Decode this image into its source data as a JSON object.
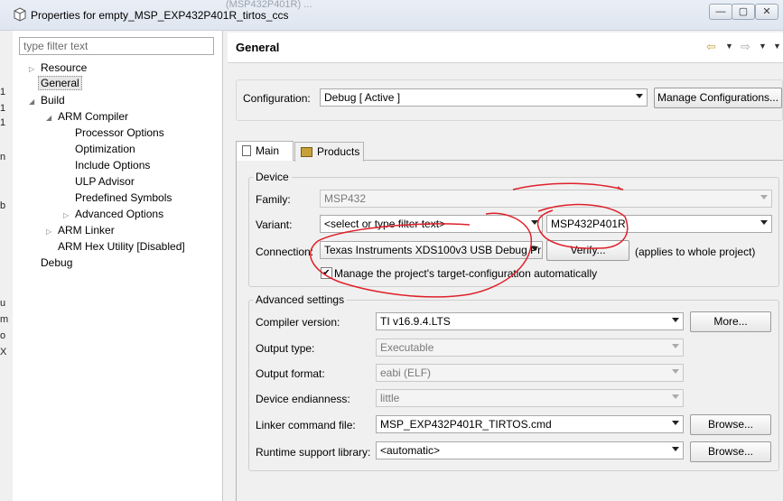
{
  "window": {
    "title": "Properties for empty_MSP_EXP432P401R_tirtos_ccs",
    "background_text": "(MSP432P401R) ...",
    "minimize": "—",
    "maximize": "▢",
    "close": "✕"
  },
  "gutter": [
    "1",
    "1",
    "1",
    "n",
    "b",
    "u",
    "m",
    "o",
    "X"
  ],
  "sidebar": {
    "filter_placeholder": "type filter text",
    "items": [
      {
        "label": "Resource",
        "expandable": true
      },
      {
        "label": "General",
        "selected": true
      },
      {
        "label": "Build",
        "expandable": true,
        "expanded": true
      },
      {
        "label": "ARM Compiler",
        "expandable": true,
        "expanded": true
      },
      {
        "label": "Processor Options"
      },
      {
        "label": "Optimization"
      },
      {
        "label": "Include Options"
      },
      {
        "label": "ULP Advisor"
      },
      {
        "label": "Predefined Symbols"
      },
      {
        "label": "Advanced Options",
        "expandable": true
      },
      {
        "label": "ARM Linker",
        "expandable": true
      },
      {
        "label": "ARM Hex Utility  [Disabled]"
      },
      {
        "label": "Debug"
      }
    ]
  },
  "header": {
    "title": "General"
  },
  "configuration": {
    "label": "Configuration:",
    "value": "Debug  [ Active ]",
    "manage_button": "Manage Configurations..."
  },
  "tabs": [
    {
      "label": "Main",
      "active": true,
      "icon": "main-page-icon"
    },
    {
      "label": "Products",
      "active": false,
      "icon": "products-icon"
    }
  ],
  "device": {
    "group_title": "Device",
    "family_label": "Family:",
    "family_value": "MSP432",
    "variant_label": "Variant:",
    "variant_filter": "<select or type filter text>",
    "variant_value": "MSP432P401R",
    "connection_label": "Connection:",
    "connection_value": "Texas Instruments XDS100v3 USB Debug Pr",
    "verify_button": "Verify...",
    "connection_note": "(applies to whole project)",
    "manage_checkbox_label": "Manage the project's target-configuration automatically",
    "manage_checked": true
  },
  "advanced": {
    "group_title": "Advanced settings",
    "compiler_label": "Compiler version:",
    "compiler_value": "TI v16.9.4.LTS",
    "more_button": "More...",
    "output_type_label": "Output type:",
    "output_type_value": "Executable",
    "output_format_label": "Output format:",
    "output_format_value": "eabi (ELF)",
    "endianness_label": "Device endianness:",
    "endianness_value": "little",
    "linker_label": "Linker command file:",
    "linker_value": "MSP_EXP432P401R_TIRTOS.cmd",
    "browse_button": "Browse...",
    "runtime_label": "Runtime support library:",
    "runtime_value": "<automatic>",
    "browse_button_2": "Browse..."
  },
  "colors": {
    "annotation": "#e0202a",
    "accent_icon": "#c8a03a"
  }
}
